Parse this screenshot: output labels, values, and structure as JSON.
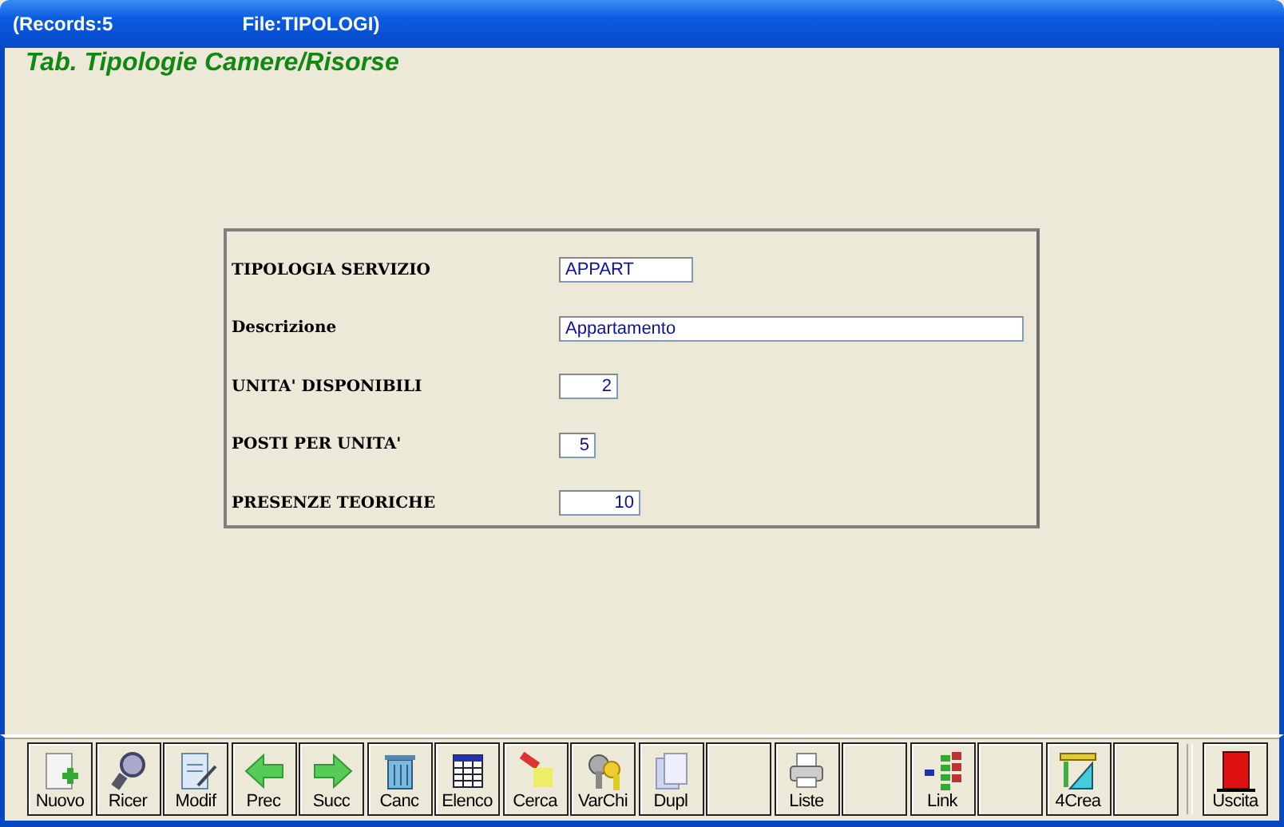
{
  "window": {
    "title_parts": [
      "(Records:5",
      "File:TIPOLOGI)"
    ]
  },
  "heading": "Tab. Tipologie Camere/Risorse",
  "form": {
    "fields": [
      {
        "label": "TIPOLOGIA SERVIZIO",
        "value": "APPART",
        "kind": "text"
      },
      {
        "label": "Descrizione",
        "value": "Appartamento",
        "kind": "text"
      },
      {
        "label": "UNITA' DISPONIBILI",
        "value": "2",
        "kind": "number"
      },
      {
        "label": "POSTI PER UNITA'",
        "value": "5",
        "kind": "number"
      },
      {
        "label": "PRESENZE TEORICHE",
        "value": "10",
        "kind": "number"
      }
    ]
  },
  "toolbar": {
    "buttons": [
      {
        "kind": "labeled",
        "label": "Nuovo"
      },
      {
        "kind": "labeled",
        "label": "Ricer"
      },
      {
        "kind": "labeled",
        "label": "Modif"
      },
      {
        "kind": "labeled",
        "label": "Prec"
      },
      {
        "kind": "labeled",
        "label": "Succ"
      },
      {
        "kind": "labeled",
        "label": "Canc"
      },
      {
        "kind": "labeled",
        "label": "Elenco"
      },
      {
        "kind": "labeled",
        "label": "Cerca"
      },
      {
        "kind": "labeled",
        "label": "VarChi"
      },
      {
        "kind": "labeled",
        "label": "Dupl"
      },
      {
        "kind": "blank"
      },
      {
        "kind": "labeled",
        "label": "Liste"
      },
      {
        "kind": "blank"
      },
      {
        "kind": "labeled",
        "label": "Link"
      },
      {
        "kind": "blank"
      },
      {
        "kind": "labeled",
        "label": "4Crea"
      },
      {
        "kind": "blank"
      }
    ],
    "exit_button": {
      "label": "Uscita"
    }
  }
}
